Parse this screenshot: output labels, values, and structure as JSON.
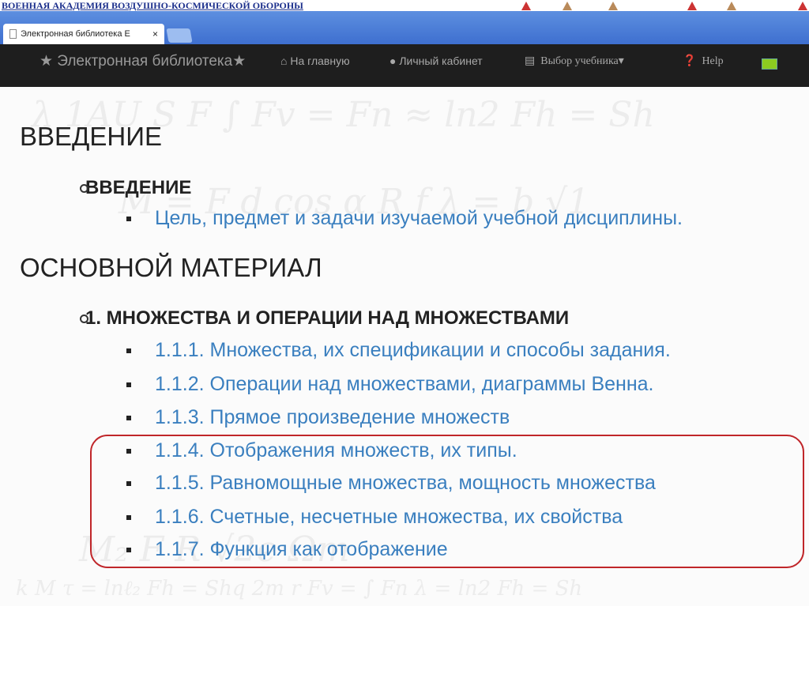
{
  "banner": {
    "title": "ВОЕННАЯ АКАДЕМИЯ ВОЗДУШНО-КОСМИЧЕСКОЙ ОБОРОНЫ"
  },
  "browser": {
    "tab_title": "Электронная библиотека Е",
    "close": "×"
  },
  "nav": {
    "brand": "★ Электронная библиотека★",
    "home": "На главную",
    "cabinet": "Личный кабинет",
    "choose": "Выбор  учебника",
    "help": "Help"
  },
  "content": {
    "section1": "ВВЕДЕНИЕ",
    "sub1": "ВВЕДЕНИЕ",
    "sub1_items": [
      "Цель, предмет и задачи изучаемой учебной дисциплины."
    ],
    "section2": "ОСНОВНОЙ МАТЕРИАЛ",
    "sub2": "1. МНОЖЕСТВА И ОПЕРАЦИИ НАД МНОЖЕСТВАМИ",
    "sub2_items": [
      "1.1.1. Множества, их спецификации и способы задания.",
      "1.1.2. Операции над множествами, диаграммы Венна.",
      "1.1.3. Прямое произведение множеств",
      "1.1.4. Отображения множеств, их типы.",
      "1.1.5. Равномощные множества, мощность множества",
      "1.1.6. Счетные, несчетные множества, их свойства",
      "1.1.7. Функция как отображение"
    ]
  },
  "colors": {
    "highlight": "#c0262a",
    "link": "#3a7fbf",
    "navbar": "#1e1e1e"
  }
}
